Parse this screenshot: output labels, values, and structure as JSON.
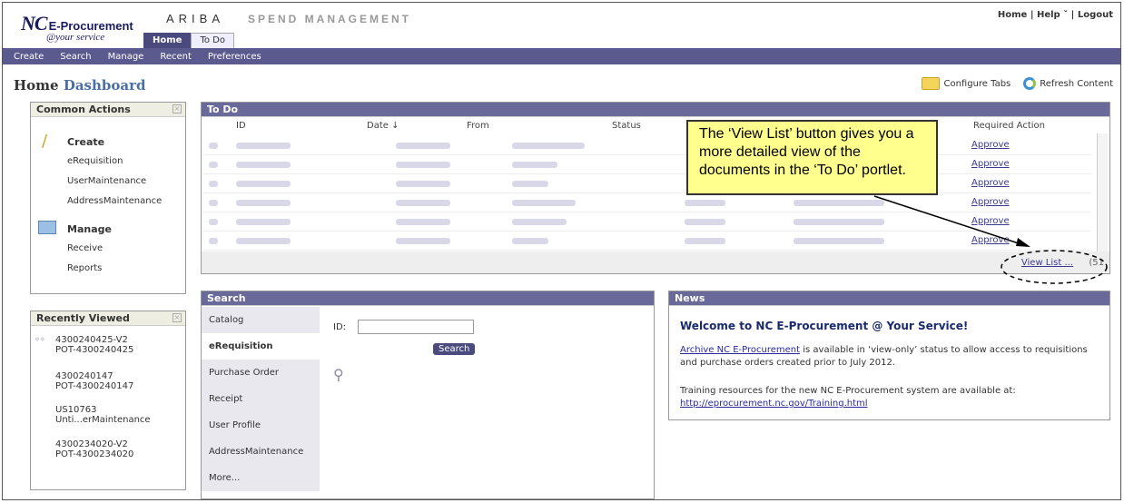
{
  "brand": {
    "logo_nc": "NC",
    "logo_ep": "E-Procurement",
    "logo_ys": "@your service",
    "ariba": "ARIBA",
    "spend": "SPEND MANAGEMENT"
  },
  "toplinks": {
    "home": "Home",
    "help": "Help",
    "logout": "Logout"
  },
  "tabs": [
    "Home",
    "To Do"
  ],
  "nav": [
    "Create",
    "Search",
    "Manage",
    "Recent",
    "Preferences"
  ],
  "dashboard": {
    "title1": "Home",
    "title2": "Dashboard",
    "configure": "Configure Tabs",
    "refresh": "Refresh Content"
  },
  "common": {
    "title": "Common Actions",
    "create": "Create",
    "create_items": [
      "eRequisition",
      "UserMaintenance",
      "AddressMaintenance"
    ],
    "manage": "Manage",
    "manage_items": [
      "Receive",
      "Reports"
    ]
  },
  "recent": {
    "title": "Recently Viewed",
    "items": [
      [
        "4300240425-V2",
        "POT-4300240425"
      ],
      [
        "4300240147",
        "POT-4300240147"
      ],
      [
        "US10763",
        "Unti...erMaintenance"
      ],
      [
        "4300234020-V2",
        "POT-4300234020"
      ]
    ]
  },
  "todo": {
    "title": "To Do",
    "cols": [
      "ID",
      "Date ↓",
      "From",
      "Status",
      "Required Action"
    ],
    "action": "Approve",
    "view_list": "View List ...",
    "count": "(51"
  },
  "callout": "The ‘View List’ button gives you a more detailed view of the documents in the ‘To Do’ portlet.",
  "search": {
    "title": "Search",
    "tabs": [
      "Catalog",
      "eRequisition",
      "Purchase Order",
      "Receipt",
      "User Profile",
      "AddressMaintenance",
      "More..."
    ],
    "id_label": "ID:",
    "button": "Search"
  },
  "news": {
    "title": "News",
    "heading": "Welcome to NC E-Procurement @ Your Service!",
    "p1_link": "Archive NC E-Procurement",
    "p1_rest": " is available in ‘view-only’ status to allow access to requisitions and purchase orders created prior to July 2012.",
    "p2": "Training resources for the new NC E-Procurement system are available at:",
    "p2_link": "http://eprocurement.nc.gov/Training.html"
  }
}
